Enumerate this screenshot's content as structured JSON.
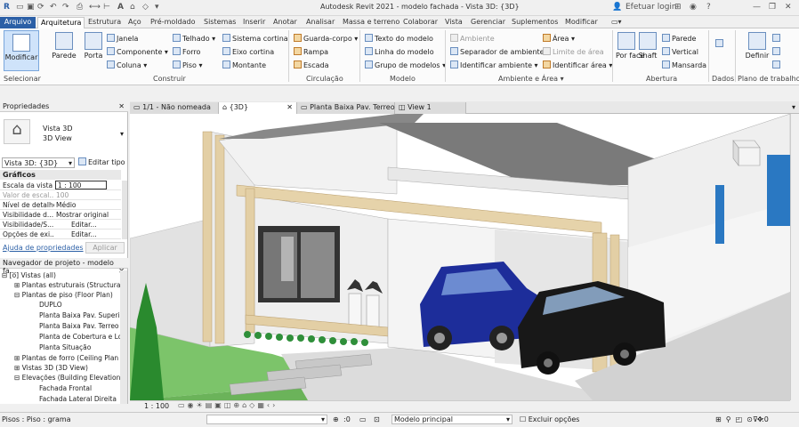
{
  "titlebar": {
    "title": "Autodesk Revit 2021 - modelo fachada - Vista 3D: {3D}",
    "login": "Efetuar login"
  },
  "tabs": [
    "Arquivo",
    "Arquitetura",
    "Estrutura",
    "Aço",
    "Pré-moldado",
    "Sistemas",
    "Inserir",
    "Anotar",
    "Analisar",
    "Massa e terreno",
    "Colaborar",
    "Vista",
    "Gerenciar",
    "Suplementos",
    "Modificar"
  ],
  "ribbon": {
    "modify": "Modificar",
    "select": "Selecionar",
    "build": {
      "wall": "Parede",
      "door": "Porta",
      "window": "Janela",
      "component": "Componente",
      "column": "Coluna",
      "roof": "Telhado",
      "ceiling": "Forro",
      "floor": "Piso",
      "curtain_system": "Sistema cortina",
      "curtain_grid": "Eixo cortina",
      "mullion": "Montante",
      "panel": "Construir"
    },
    "circulation": {
      "railing": "Guarda-corpo",
      "ramp": "Rampa",
      "stair": "Escada",
      "panel": "Circulação"
    },
    "model": {
      "text": "Texto do modelo",
      "line": "Linha do modelo",
      "group": "Grupo de modelos",
      "panel": "Modelo"
    },
    "room": {
      "room": "Ambiente",
      "separator": "Separador de ambiente",
      "tag": "Identificar ambiente",
      "area": "Área",
      "boundary": "Limite de área",
      "tag_area": "Identificar área",
      "panel": "Ambiente e Área"
    },
    "opening": {
      "by_face": "Por face",
      "shaft": "Shaft",
      "wall": "Parede",
      "vertical": "Vertical",
      "dormer": "Mansarda",
      "panel": "Abertura"
    },
    "datum": {
      "panel": "Dados"
    },
    "workplane": {
      "set": "Definir",
      "panel": "Plano de trabalho"
    }
  },
  "properties": {
    "header": "Propriedades",
    "type_name": "Vista 3D",
    "type_sub": "3D View",
    "selector": "Vista 3D: {3D}",
    "edit_type": "Editar tipo",
    "group": "Gráficos",
    "rows": [
      {
        "k": "Escala da vista",
        "v": "1 : 100"
      },
      {
        "k": "Valor de escal...",
        "v": "100"
      },
      {
        "k": "Nível de detalhe",
        "v": "Médio"
      },
      {
        "k": "Visibilidade d...",
        "v": "Mostrar original"
      },
      {
        "k": "Visibilidade/S...",
        "v": "Editar..."
      },
      {
        "k": "Opções de exi...",
        "v": "Editar..."
      }
    ],
    "help": "Ajuda de propriedades",
    "apply": "Aplicar"
  },
  "browser": {
    "header": "Navegador de projeto - modelo fa...",
    "items": [
      "Vistas (all)",
      "Plantas estruturais (Structural",
      "Plantas de piso (Floor Plan)",
      "DUPLO",
      "Planta Baixa Pav. Superio",
      "Planta Baixa Pav. Terreo",
      "Planta de Cobertura e Loc",
      "Planta Situação",
      "Plantas de forro (Ceiling Plan",
      "Vistas 3D (3D View)",
      "Elevações (Building Elevation",
      "Fachada Frontal",
      "Fachada Lateral Direita"
    ]
  },
  "viewtabs": [
    "1/1 - Não nomeada",
    "{3D}",
    "Planta Baixa Pav. Terreo",
    "View 1"
  ],
  "viewbar": {
    "scale": "1 : 100"
  },
  "status": {
    "text": "Pisos : Piso : grama",
    "count": ":0",
    "model": "Modelo principal",
    "exclude": "Excluir opções",
    "filter": ":0"
  }
}
